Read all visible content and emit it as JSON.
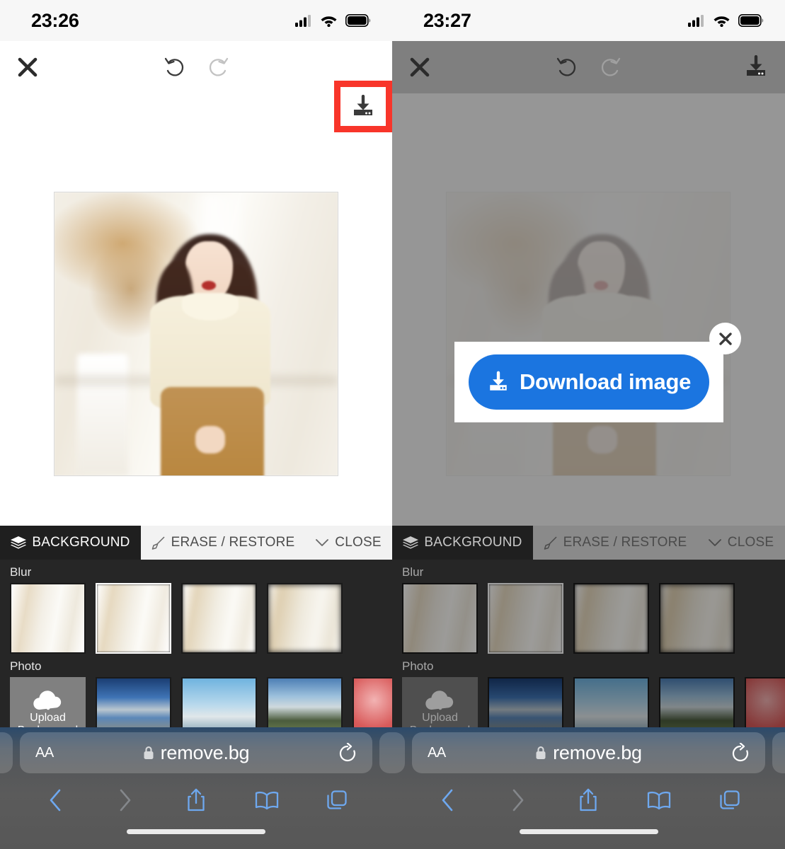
{
  "panels": [
    {
      "id": "before",
      "status": {
        "time": "23:26",
        "signal_icon": "cellular-signal-icon",
        "wifi_icon": "wifi-icon",
        "battery_icon": "battery-icon"
      },
      "toolbar": {
        "close_icon": "close-icon",
        "undo_icon": "undo-icon",
        "redo_icon": "redo-icon",
        "download_icon": "download-icon",
        "highlight_color": "#f8352a",
        "highlighted": true
      },
      "tabs": [
        {
          "label": "BACKGROUND",
          "icon": "layers-icon",
          "active": true
        },
        {
          "label": "ERASE / RESTORE",
          "icon": "brush-icon",
          "active": false
        },
        {
          "label": "CLOSE",
          "icon": "chevron-down-icon",
          "active": false
        }
      ],
      "sections": [
        {
          "label": "Blur",
          "items": [
            {
              "name": "blur-none",
              "selected": false
            },
            {
              "name": "blur-light",
              "selected": true
            },
            {
              "name": "blur-medium",
              "selected": false
            },
            {
              "name": "blur-strong",
              "selected": false
            }
          ]
        },
        {
          "label": "Photo",
          "upload": {
            "label_line1": "Upload",
            "label_line2": "Background",
            "icon": "cloud-upload-icon"
          },
          "items": [
            {
              "name": "photo-lake-mountains",
              "selected": false
            },
            {
              "name": "photo-city-skyline",
              "selected": false
            },
            {
              "name": "photo-cabin-hills",
              "selected": false
            },
            {
              "name": "photo-red-bokeh",
              "selected": false
            }
          ]
        }
      ],
      "browser": {
        "text_size_label": "AA",
        "lock_icon": "lock-icon",
        "url": "remove.bg",
        "reload_icon": "reload-icon",
        "back_icon": "back-chevron-icon",
        "forward_icon": "forward-chevron-icon",
        "share_icon": "share-icon",
        "bookmarks_icon": "book-icon",
        "tabs_icon": "tabs-icon"
      },
      "modal": null
    },
    {
      "id": "after",
      "status": {
        "time": "23:27",
        "signal_icon": "cellular-signal-icon",
        "wifi_icon": "wifi-icon",
        "battery_icon": "battery-icon"
      },
      "toolbar": {
        "close_icon": "close-icon",
        "undo_icon": "undo-icon",
        "redo_icon": "redo-icon",
        "download_icon": "download-icon",
        "highlight_color": "#f8352a",
        "highlighted": false
      },
      "tabs": [
        {
          "label": "BACKGROUND",
          "icon": "layers-icon",
          "active": true
        },
        {
          "label": "ERASE / RESTORE",
          "icon": "brush-icon",
          "active": false
        },
        {
          "label": "CLOSE",
          "icon": "chevron-down-icon",
          "active": false
        }
      ],
      "sections": [
        {
          "label": "Blur",
          "items": [
            {
              "name": "blur-none",
              "selected": false
            },
            {
              "name": "blur-light",
              "selected": true
            },
            {
              "name": "blur-medium",
              "selected": false
            },
            {
              "name": "blur-strong",
              "selected": false
            }
          ]
        },
        {
          "label": "Photo",
          "upload": {
            "label_line1": "Upload",
            "label_line2": "Background",
            "icon": "cloud-upload-icon"
          },
          "items": [
            {
              "name": "photo-lake-mountains",
              "selected": false
            },
            {
              "name": "photo-city-skyline",
              "selected": false
            },
            {
              "name": "photo-cabin-hills",
              "selected": false
            },
            {
              "name": "photo-red-bokeh",
              "selected": false
            }
          ]
        }
      ],
      "browser": {
        "text_size_label": "AA",
        "lock_icon": "lock-icon",
        "url": "remove.bg",
        "reload_icon": "reload-icon",
        "back_icon": "back-chevron-icon",
        "forward_icon": "forward-chevron-icon",
        "share_icon": "share-icon",
        "bookmarks_icon": "book-icon",
        "tabs_icon": "tabs-icon"
      },
      "modal": {
        "button_label": "Download image",
        "button_icon": "download-icon",
        "button_color": "#1b75e0",
        "close_icon": "close-icon"
      }
    }
  ]
}
